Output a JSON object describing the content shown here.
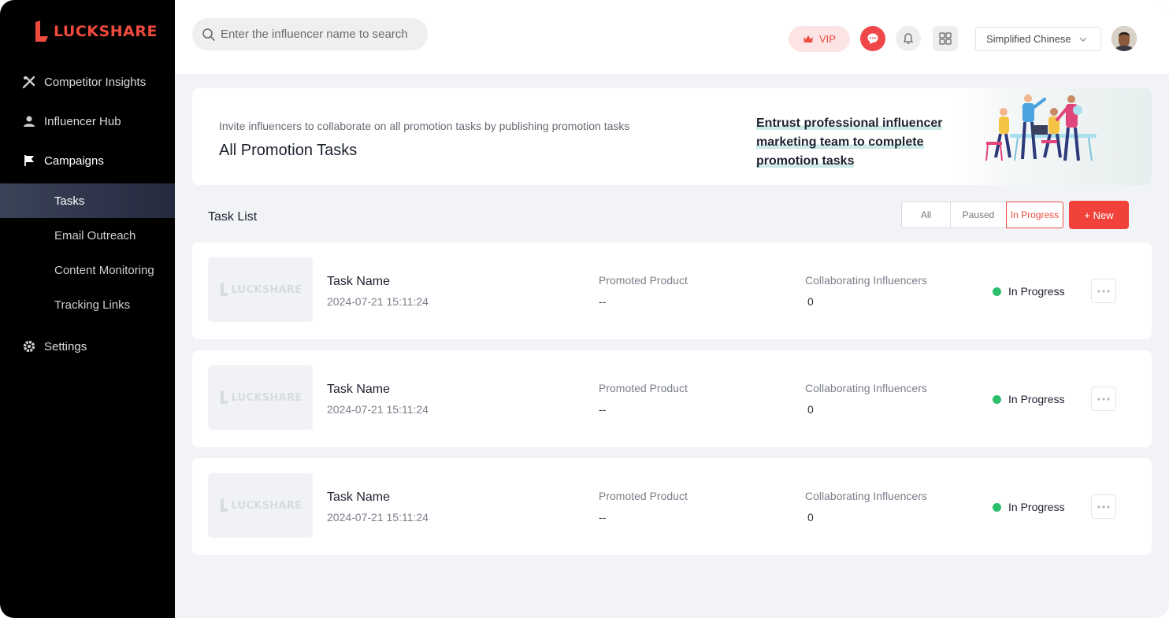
{
  "brand": {
    "name": "LUCKSHARE",
    "color": "#ef4a3e"
  },
  "sidebar": {
    "items": [
      {
        "label": "Competitor Insights",
        "icon": "competitor-icon"
      },
      {
        "label": "Influencer Hub",
        "icon": "influencer-icon"
      },
      {
        "label": "Campaigns",
        "icon": "flag-icon"
      }
    ],
    "sub_items": [
      {
        "label": "Tasks",
        "active": true
      },
      {
        "label": "Email Outreach"
      },
      {
        "label": "Content Monitoring"
      },
      {
        "label": "Tracking Links"
      }
    ],
    "settings": {
      "label": "Settings",
      "icon": "gear-icon"
    }
  },
  "header": {
    "search_placeholder": "Enter the influencer name to search",
    "vip_label": "VIP",
    "language": "Simplified Chinese"
  },
  "banner": {
    "subtitle": "Invite influencers to collaborate on all promotion tasks by publishing promotion tasks",
    "title": "All Promotion Tasks",
    "promo_text": "Entrust professional influencer marketing team to complete promotion tasks"
  },
  "task_list": {
    "title": "Task List",
    "tabs": [
      "All",
      "Paused",
      "In Progress"
    ],
    "active_tab": "In Progress",
    "new_button": "+ New",
    "product_label": "Promoted Product",
    "influencers_label": "Collaborating Influencers",
    "thumb_text": "LUCKSHARE",
    "tasks": [
      {
        "name": "Task Name",
        "date": "2024-07-21 15:11:24",
        "product": "--",
        "influencers": "0",
        "status": "In Progress"
      },
      {
        "name": "Task Name",
        "date": "2024-07-21 15:11:24",
        "product": "--",
        "influencers": "0",
        "status": "In Progress"
      },
      {
        "name": "Task Name",
        "date": "2024-07-21 15:11:24",
        "product": "--",
        "influencers": "0",
        "status": "In Progress"
      }
    ]
  },
  "colors": {
    "accent": "#f0413a",
    "status_green": "#2dbe6c",
    "sidebar_bg": "#000000"
  }
}
